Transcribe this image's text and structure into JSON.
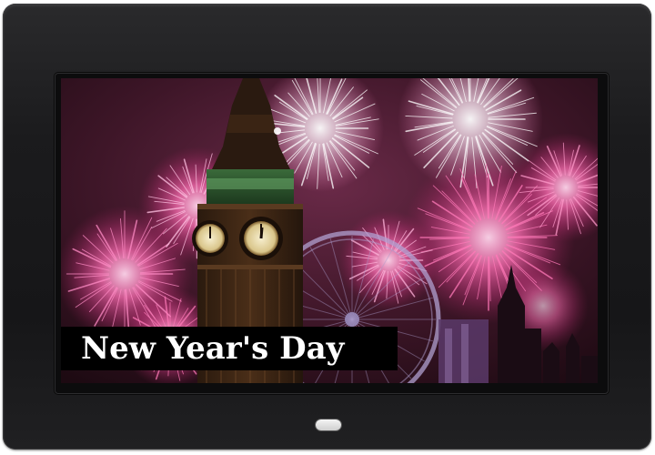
{
  "photo_frame": {
    "caption": "New Year's Day",
    "scene": "big-ben-fireworks-photo",
    "colors": {
      "frame": "#1b1b1d",
      "caption_background": "#000000",
      "caption_text": "#ffffff",
      "firework_pink": "#ff5fa8",
      "firework_white": "#ffffff",
      "tower": "#3a2414",
      "clock_face": "#e9dcb0",
      "sky": "#4a1a2e"
    },
    "controls": {
      "power_button_icon": "power-button"
    }
  }
}
